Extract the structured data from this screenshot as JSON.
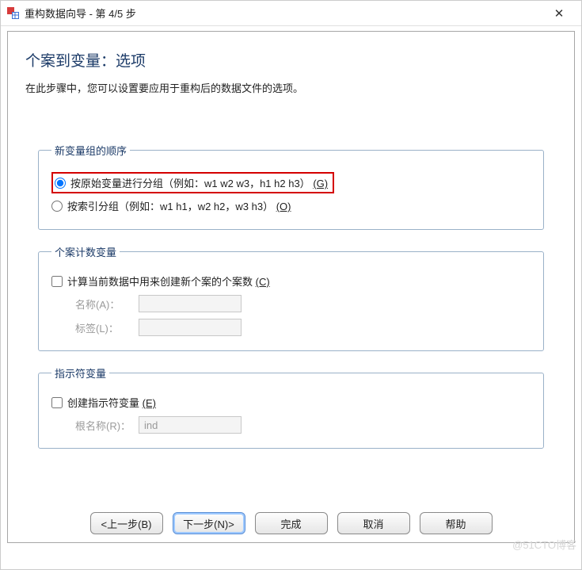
{
  "window": {
    "title": "重构数据向导 - 第 4/5 步"
  },
  "page": {
    "heading": "个案到变量：选项",
    "description": "在此步骤中，您可以设置要应用于重构后的数据文件的选项。"
  },
  "order_group": {
    "legend": "新变量组的顺序",
    "opt1_label": "按原始变量进行分组（例如：w1 w2 w3，h1 h2 h3）",
    "opt1_mnemonic": "(G)",
    "opt2_label": "按索引分组（例如：w1 h1，w2 h2，w3 h3）",
    "opt2_mnemonic": "(O)",
    "selected": "opt1"
  },
  "count_group": {
    "legend": "个案计数变量",
    "check_label": "计算当前数据中用来创建新个案的个案数",
    "check_mnemonic": "(C)",
    "name_label": "名称(A)：",
    "name_value": "",
    "tag_label": "标签(L)：",
    "tag_value": ""
  },
  "indicator_group": {
    "legend": "指示符变量",
    "check_label": "创建指示符变量",
    "check_mnemonic": "(E)",
    "root_label": "根名称(R)：",
    "root_value": "ind"
  },
  "buttons": {
    "back": "<上一步(B)",
    "next": "下一步(N)>",
    "finish": "完成",
    "cancel": "取消",
    "help": "帮助"
  },
  "watermark": "@51CTO博客"
}
